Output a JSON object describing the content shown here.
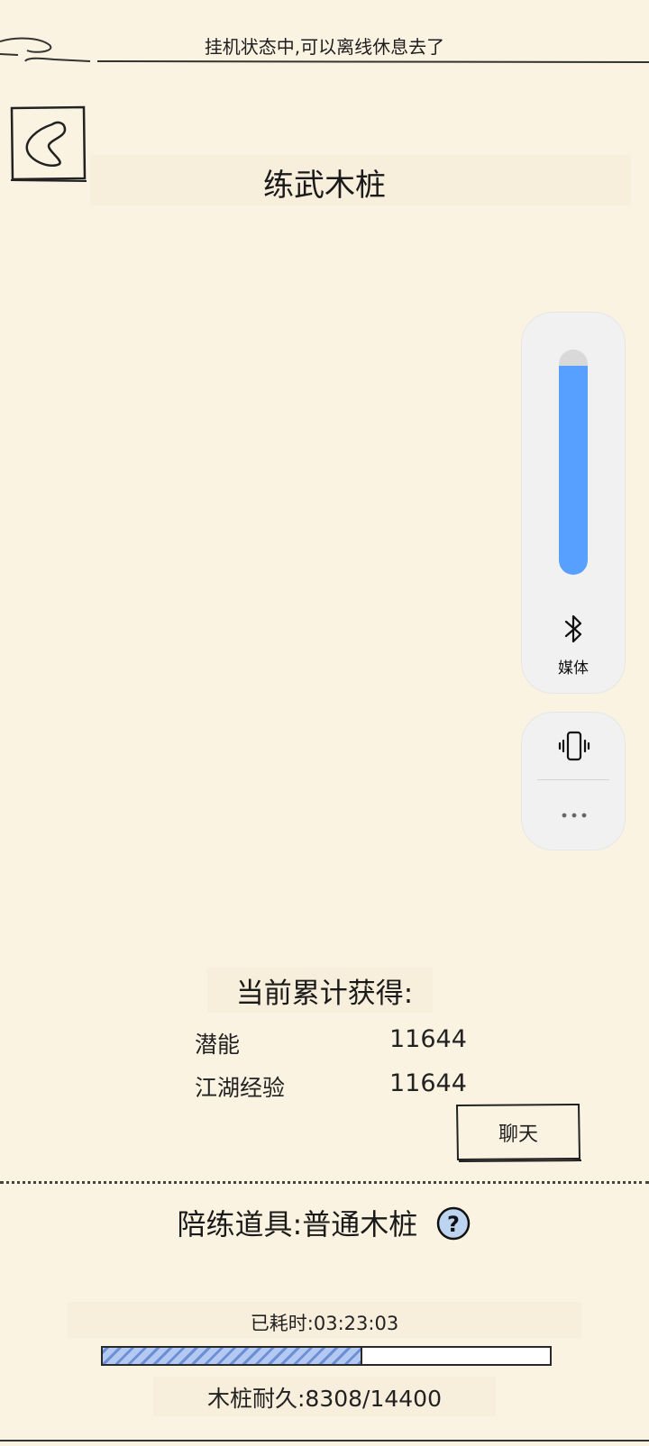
{
  "header": {
    "status_message": "挂机状态中,可以离线休息去了",
    "title": "练武木桩"
  },
  "volume_panel": {
    "level": 0.93,
    "media_label": "媒体",
    "bluetooth_icon": "bluetooth-icon",
    "vibrate_icon": "vibrate-icon",
    "more_icon": "more-icon",
    "accent": "#58a0ff"
  },
  "rewards": {
    "heading": "当前累计获得:",
    "items": [
      {
        "name": "潜能",
        "value": "11644"
      },
      {
        "name": "江湖经验",
        "value": "11644"
      }
    ]
  },
  "chat_button": {
    "label": "聊天"
  },
  "practice_tool": {
    "label": "陪练道具:",
    "name": "普通木桩",
    "help_icon": "question-icon"
  },
  "progress": {
    "elapsed_label": "已耗时:",
    "elapsed_value": "03:23:03",
    "fraction": 0.577,
    "durability_text": "木桩耐久:8308/14400"
  },
  "colors": {
    "background": "#fbf3e2",
    "progress_fill": "#9bb8ee"
  }
}
